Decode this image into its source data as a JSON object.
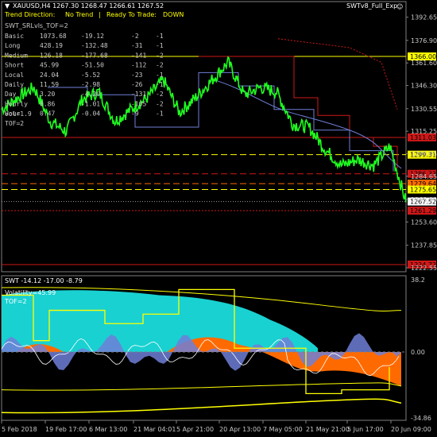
{
  "header": {
    "symbol_line": "XAUUSD,H4  1267.30 1268.47 1266.61 1267.52",
    "trend_label": "Trend Direction:",
    "trend_value": "No Trend",
    "separator": "|",
    "ready_label": "Ready To Trade:",
    "ready_value": "DOWN",
    "expert_name": "SWTv8_Full_Exp",
    "smiley": "☺"
  },
  "info_panel": {
    "title": "SWT_SRLvls_TOF=2",
    "rows": [
      {
        "name": "Basic",
        "a": "1073.68",
        "b": "-19.12",
        "c": "-2",
        "d": "-1"
      },
      {
        "name": "Long",
        "a": "428.19",
        "b": "-132.48",
        "c": "-31",
        "d": "-1"
      },
      {
        "name": "Medium",
        "a": "126.18",
        "b": "-177.68",
        "c": "-141",
        "d": "-2"
      },
      {
        "name": "Short",
        "a": "45.99",
        "b": "-51.50",
        "c": "-112",
        "d": "-2"
      },
      {
        "name": "Local",
        "a": "24.04",
        "b": "-5.52",
        "c": "-23",
        "d": "-1"
      },
      {
        "name": "Daily",
        "a": "11.59",
        "b": "-2.98",
        "c": "-26",
        "d": "-1"
      },
      {
        "name": "Day",
        "a": "3.20",
        "b": "-4.20",
        "c": "-131",
        "d": "-2"
      },
      {
        "name": "Hourly",
        "a": "0.86",
        "b": "-1.01",
        "c": "-105",
        "d": "-2"
      },
      {
        "name": "Hour",
        "a": "0.47",
        "b": "-0.04",
        "c": "-9",
        "d": "-1"
      }
    ],
    "extra": [
      "Vol=1.9",
      "TOF=2"
    ]
  },
  "colors": {
    "price": "#20ff20",
    "yellow": "#ffff00",
    "red": "#d01818",
    "orange": "#ff6a00",
    "blue": "#6f7fd8",
    "cyan": "#19d1d1",
    "grid_text": "#c8c8c8"
  },
  "chart_data": [
    {
      "type": "line",
      "title": "XAUUSD,H4",
      "ylim": [
        1222.0,
        1400.0
      ],
      "y_ticks": [
        "1392.65",
        "1376.90",
        "1361.60",
        "1346.30",
        "1330.55",
        "1315.25",
        "1299.95",
        "1284.65",
        "1268.90",
        "1253.60",
        "1237.85",
        "1222.55"
      ],
      "x_ticks": [
        "5 Feb 2018",
        "19 Feb 17:00",
        "6 Mar 13:00",
        "21 Mar 04:01",
        "5 Apr 21:00",
        "20 Apr 13:00",
        "7 May 05:00",
        "21 May 21:00",
        "5 Jun 17:00",
        "20 Jun 09:00"
      ],
      "price_x": [
        0,
        4,
        8,
        12,
        16,
        20,
        24,
        28,
        32,
        36,
        40,
        44,
        48,
        52,
        56,
        60,
        64,
        68,
        72,
        76,
        80,
        84,
        88,
        92,
        96,
        100
      ],
      "price_y": [
        1330,
        1338,
        1345,
        1322,
        1315,
        1337,
        1342,
        1322,
        1330,
        1338,
        1350,
        1328,
        1338,
        1350,
        1362,
        1340,
        1345,
        1342,
        1320,
        1318,
        1303,
        1292,
        1296,
        1292,
        1305,
        1267
      ],
      "levels": [
        {
          "value": 1366.0,
          "label": "1366.00",
          "color": "#ffff00",
          "style": "solid"
        },
        {
          "value": 1311.03,
          "label": "1311.03",
          "color": "#d01818",
          "style": "solid"
        },
        {
          "value": 1299.31,
          "label": "1299.31",
          "color": "#ffff00",
          "style": "dashed"
        },
        {
          "value": 1286.33,
          "label": "1286.33",
          "color": "#d01818",
          "style": "dashed"
        },
        {
          "value": 1279.64,
          "label": "1279.64",
          "color": "#ff6a00",
          "style": "dashed"
        },
        {
          "value": 1275.65,
          "label": "1275.65",
          "color": "#ffff00",
          "style": "dashed"
        },
        {
          "value": 1267.52,
          "label": "1267.52",
          "color": "#ffffff",
          "style": "current"
        },
        {
          "value": 1261.29,
          "label": "1261.29",
          "color": "#d01818",
          "style": "dotted"
        },
        {
          "value": 1224.72,
          "label": "1224.72",
          "color": "#d01818",
          "style": "solid"
        }
      ]
    },
    {
      "type": "area",
      "title": "SWT -14.12 -17.00 -8.79",
      "subtitle_lines": [
        "Volatility=45.99",
        "TOF=2"
      ],
      "ylim": [
        -34.86,
        38.2
      ],
      "y_ticks": [
        "38.2",
        "0.00",
        "-34.86"
      ]
    }
  ]
}
